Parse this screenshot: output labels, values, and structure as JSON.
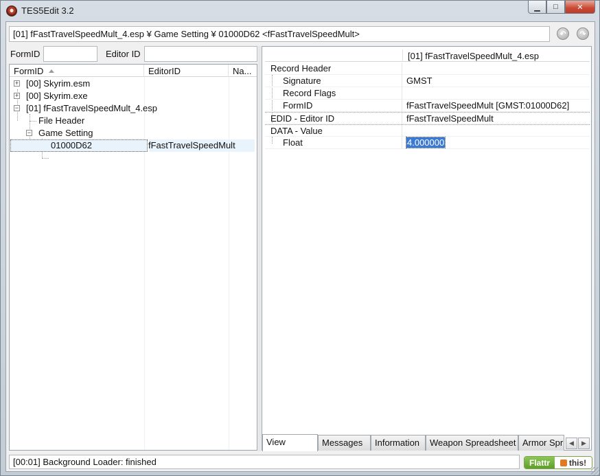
{
  "window": {
    "title": "TES5Edit 3.2",
    "minimize_glyph": "▁",
    "maximize_glyph": "□",
    "close_glyph": "✕"
  },
  "pathbar": {
    "text": "[01] fFastTravelSpeedMult_4.esp ¥ Game Setting ¥ 01000D62 <fFastTravelSpeedMult>",
    "back_icon": "back-arrow-icon",
    "forward_icon": "forward-arrow-icon"
  },
  "filters": {
    "formid_label": "FormID",
    "editorid_label": "Editor ID",
    "formid_value": "",
    "editorid_value": ""
  },
  "tree": {
    "columns": [
      "FormID",
      "EditorID",
      "Na..."
    ],
    "rows": [
      {
        "label": "[00] Skyrim.esm",
        "editor_id": "",
        "expander": "+"
      },
      {
        "label": "[00] Skyrim.exe",
        "editor_id": "",
        "expander": "+"
      },
      {
        "label": "[01] fFastTravelSpeedMult_4.esp",
        "editor_id": "",
        "expander": "−"
      },
      {
        "label": "File Header",
        "editor_id": "",
        "expander": ""
      },
      {
        "label": "Game Setting",
        "editor_id": "",
        "expander": "−"
      },
      {
        "label": "01000D62",
        "editor_id": "fFastTravelSpeedMult",
        "expander": ""
      }
    ]
  },
  "record_view": {
    "column_header": "[01] fFastTravelSpeedMult_4.esp",
    "rows": [
      {
        "name": "Record Header",
        "value": ""
      },
      {
        "name": "Signature",
        "value": "GMST"
      },
      {
        "name": "Record Flags",
        "value": ""
      },
      {
        "name": "FormID",
        "value": "fFastTravelSpeedMult [GMST:01000D62]"
      },
      {
        "name": "EDID - Editor ID",
        "value": "fFastTravelSpeedMult"
      },
      {
        "name": "DATA - Value",
        "value": ""
      },
      {
        "name": "Float",
        "value": "4.000000"
      }
    ]
  },
  "tabs": [
    "View",
    "Messages",
    "Information",
    "Weapon Spreadsheet",
    "Armor Spr"
  ],
  "tab_scroll": {
    "left": "◀",
    "right": "▶"
  },
  "status": {
    "text": "[00:01] Background Loader: finished"
  },
  "flattr": {
    "left_label": "Flattr",
    "right_label": "this!"
  },
  "colors": {
    "selection_highlight": "#3b79d4",
    "flattr_green": "#6eaf38"
  }
}
